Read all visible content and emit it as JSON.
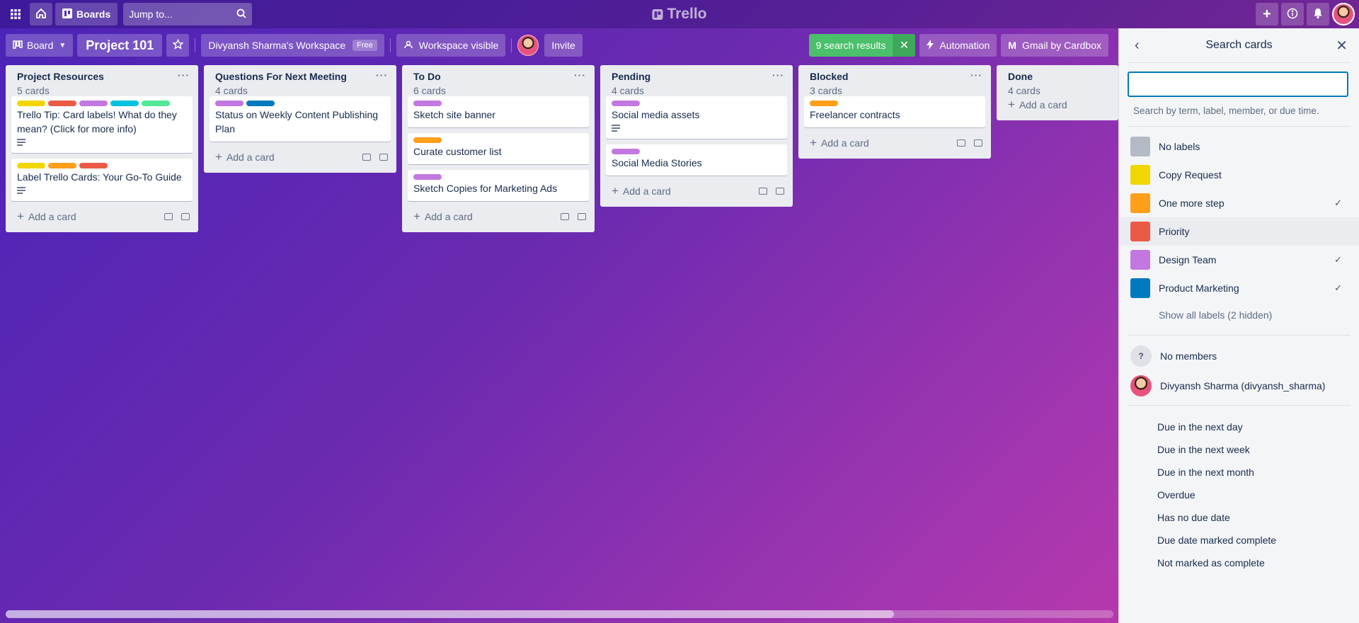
{
  "topbar": {
    "boards_label": "Boards",
    "jump_placeholder": "Jump to...",
    "logo_text": "Trello"
  },
  "boardbar": {
    "view_label": "Board",
    "board_title": "Project 101",
    "workspace_label": "Divyansh Sharma's Workspace",
    "workspace_badge": "Free",
    "visibility_label": "Workspace visible",
    "invite_label": "Invite",
    "search_results_label": "9 search results",
    "automation_label": "Automation",
    "gmail_label": "Gmail by Cardbox"
  },
  "colors": {
    "yellow": "#f2d600",
    "orange": "#ff9f1a",
    "red": "#eb5a46",
    "purple": "#c377e0",
    "sky": "#00c2e0",
    "lime": "#51e898",
    "blue": "#0079bf",
    "gray": "#b3bac5"
  },
  "lists": [
    {
      "title": "Project Resources",
      "count": "5 cards",
      "cards": [
        {
          "text": "Trello Tip: Card labels! What do they mean? (Click for more info)",
          "labels": [
            "yellow",
            "red",
            "purple",
            "sky",
            "lime"
          ],
          "has_desc": true
        },
        {
          "text": "Label Trello Cards: Your Go-To Guide",
          "labels": [
            "yellow",
            "orange",
            "red"
          ],
          "has_desc": true
        }
      ]
    },
    {
      "title": "Questions For Next Meeting",
      "count": "4 cards",
      "cards": [
        {
          "text": "Status on Weekly Content Publishing Plan",
          "labels": [
            "purple",
            "blue"
          ],
          "has_desc": false
        }
      ]
    },
    {
      "title": "To Do",
      "count": "6 cards",
      "cards": [
        {
          "text": "Sketch site banner",
          "labels": [
            "purple"
          ],
          "has_desc": false
        },
        {
          "text": "Curate customer list",
          "labels": [
            "orange"
          ],
          "has_desc": false
        },
        {
          "text": "Sketch Copies for Marketing Ads",
          "labels": [
            "purple"
          ],
          "has_desc": false
        }
      ]
    },
    {
      "title": "Pending",
      "count": "4 cards",
      "cards": [
        {
          "text": "Social media assets",
          "labels": [
            "purple"
          ],
          "has_desc": true
        },
        {
          "text": "Social Media Stories",
          "labels": [
            "purple"
          ],
          "has_desc": false
        }
      ]
    },
    {
      "title": "Blocked",
      "count": "3 cards",
      "cards": [
        {
          "text": "Freelancer contracts",
          "labels": [
            "orange"
          ],
          "has_desc": false
        }
      ]
    },
    {
      "title": "Done",
      "count": "4 cards",
      "cards": []
    }
  ],
  "add_card_label": "Add a card",
  "search_panel": {
    "title": "Search cards",
    "input_value": "",
    "hint": "Search by term, label, member, or due time.",
    "labels": [
      {
        "name": "No labels",
        "color": "#b3bac5",
        "checked": false
      },
      {
        "name": "Copy Request",
        "color": "#f2d600",
        "checked": false
      },
      {
        "name": "One more step",
        "color": "#ff9f1a",
        "checked": true
      },
      {
        "name": "Priority",
        "color": "#eb5a46",
        "checked": false
      },
      {
        "name": "Design Team",
        "color": "#c377e0",
        "checked": true
      },
      {
        "name": "Product Marketing",
        "color": "#0079bf",
        "checked": true
      }
    ],
    "show_all_labels": "Show all labels (2 hidden)",
    "members": [
      {
        "name": "No members",
        "avatar": "?"
      },
      {
        "name": "Divyansh Sharma (divyansh_sharma)",
        "avatar": "photo"
      }
    ],
    "due_options": [
      "Due in the next day",
      "Due in the next week",
      "Due in the next month",
      "Overdue",
      "Has no due date",
      "Due date marked complete",
      "Not marked as complete"
    ]
  }
}
